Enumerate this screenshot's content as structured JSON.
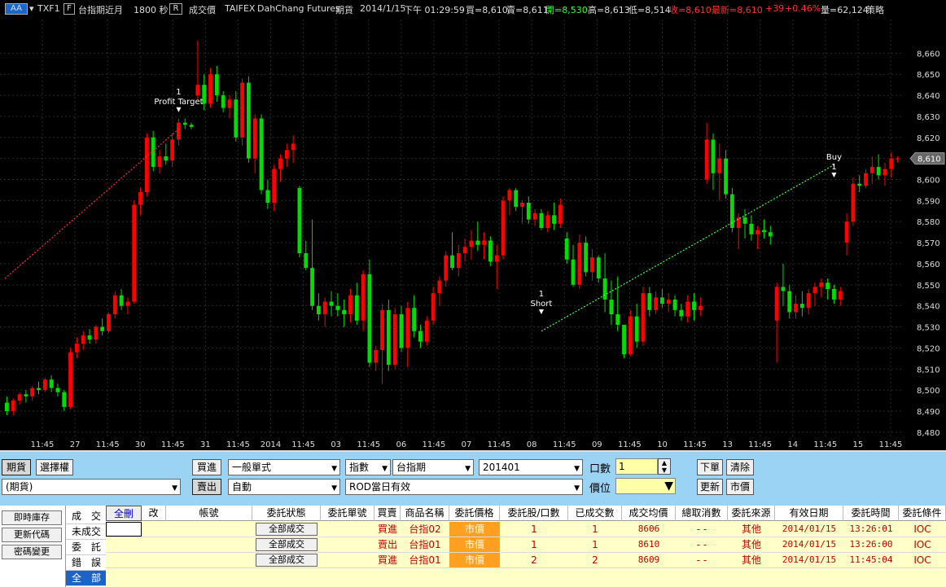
{
  "header": {
    "symbol_box": "AA",
    "symbol": "TXF1",
    "name_box": "F",
    "product": "台指期近月",
    "interval": "1800 秒",
    "r_box": "R",
    "price_type": "成交價",
    "exchange": "TAIFEX",
    "broker": "DahChang Futures",
    "category": "期貨",
    "date": "2014/1/15",
    "time": "下午 01:29:59",
    "bid": "買=8,610",
    "ask": "賣=8,611",
    "open": "開=8,530",
    "high": "高=8,613",
    "low": "低=8,514",
    "close": "收=8,610",
    "last": "最新=8,610",
    "change": "+39",
    "change_pct": "+0.46%",
    "volume": "量=62,124",
    "strategy": "策略"
  },
  "chart_data": {
    "type": "candlestick",
    "ylim": [
      8478,
      8676
    ],
    "yticks": [
      8480,
      8490,
      8500,
      8510,
      8520,
      8530,
      8540,
      8550,
      8560,
      8570,
      8580,
      8590,
      8600,
      8610,
      8620,
      8630,
      8640,
      8650,
      8660
    ],
    "ytick_labels": [
      "8,480",
      "8,490",
      "8,500",
      "8,510",
      "8,520",
      "8,530",
      "8,540",
      "8,550",
      "8,560",
      "8,570",
      "8,580",
      "8,590",
      "8,600",
      "8,610",
      "8,620",
      "8,630",
      "8,640",
      "8,650",
      "8,660"
    ],
    "last_price_label": "8,610",
    "last_price": 8610,
    "xtick_labels": [
      "11:45",
      "27",
      "11:45",
      "30",
      "11:45",
      "31",
      "11:45",
      "2014",
      "11:45",
      "03",
      "11:45",
      "06",
      "11:45",
      "07",
      "11:45",
      "08",
      "11:45",
      "09",
      "11:45",
      "10",
      "11:45",
      "13",
      "11:45",
      "14",
      "11:45",
      "15",
      "11:45"
    ],
    "candles": [
      [
        8494,
        8497,
        8488,
        8490
      ],
      [
        8490,
        8496,
        8488,
        8495
      ],
      [
        8495,
        8499,
        8493,
        8498
      ],
      [
        8498,
        8500,
        8494,
        8497
      ],
      [
        8497,
        8502,
        8495,
        8501
      ],
      [
        8501,
        8504,
        8498,
        8500
      ],
      [
        8500,
        8506,
        8499,
        8505
      ],
      [
        8505,
        8507,
        8499,
        8501
      ],
      [
        8501,
        8503,
        8497,
        8499
      ],
      [
        8499,
        8500,
        8490,
        8492
      ],
      [
        8492,
        8520,
        8491,
        8518
      ],
      [
        8518,
        8525,
        8515,
        8522
      ],
      [
        8522,
        8528,
        8519,
        8526
      ],
      [
        8526,
        8529,
        8522,
        8524
      ],
      [
        8524,
        8531,
        8522,
        8530
      ],
      [
        8530,
        8534,
        8526,
        8528
      ],
      [
        8528,
        8537,
        8527,
        8536
      ],
      [
        8536,
        8547,
        8534,
        8545
      ],
      [
        8545,
        8548,
        8538,
        8540
      ],
      [
        8540,
        8544,
        8536,
        8542
      ],
      [
        8542,
        8590,
        8541,
        8588
      ],
      [
        8588,
        8596,
        8583,
        8594
      ],
      [
        8594,
        8622,
        8592,
        8620
      ],
      [
        8620,
        8623,
        8604,
        8606
      ],
      [
        8606,
        8614,
        8603,
        8611
      ],
      [
        8611,
        8617,
        8607,
        8609
      ],
      [
        8609,
        8622,
        8606,
        8619
      ],
      [
        8619,
        8629,
        8616,
        8627
      ],
      [
        8627,
        8629,
        8624,
        8626
      ],
      [
        8626,
        8627,
        8624,
        8625
      ],
      [
        8640,
        8666,
        8638,
        8645
      ],
      [
        8645,
        8650,
        8633,
        8636
      ],
      [
        8636,
        8653,
        8634,
        8650
      ],
      [
        8650,
        8654,
        8637,
        8640
      ],
      [
        8640,
        8642,
        8632,
        8634
      ],
      [
        8634,
        8640,
        8629,
        8638
      ],
      [
        8638,
        8642,
        8618,
        8620
      ],
      [
        8620,
        8648,
        8616,
        8646
      ],
      [
        8646,
        8649,
        8608,
        8610
      ],
      [
        8610,
        8631,
        8603,
        8629
      ],
      [
        8629,
        8631,
        8593,
        8595
      ],
      [
        8595,
        8600,
        8586,
        8589
      ],
      [
        8589,
        8607,
        8585,
        8605
      ],
      [
        8605,
        8612,
        8599,
        8610
      ],
      [
        8610,
        8617,
        8606,
        8614
      ],
      [
        8614,
        8621,
        8608,
        8617
      ],
      [
        8596,
        8597,
        8563,
        8565
      ],
      [
        8565,
        8571,
        8557,
        8558
      ],
      [
        8558,
        8581,
        8538,
        8540
      ],
      [
        8540,
        8546,
        8533,
        8536
      ],
      [
        8536,
        8544,
        8530,
        8542
      ],
      [
        8542,
        8547,
        8535,
        8540
      ],
      [
        8540,
        8546,
        8535,
        8538
      ],
      [
        8538,
        8543,
        8530,
        8536
      ],
      [
        8536,
        8548,
        8532,
        8545
      ],
      [
        8545,
        8551,
        8531,
        8533
      ],
      [
        8533,
        8557,
        8528,
        8555
      ],
      [
        8555,
        8562,
        8511,
        8513
      ],
      [
        8513,
        8521,
        8509,
        8519
      ],
      [
        8519,
        8541,
        8503,
        8538
      ],
      [
        8538,
        8543,
        8509,
        8512
      ],
      [
        8512,
        8539,
        8510,
        8536
      ],
      [
        8536,
        8540,
        8518,
        8520
      ],
      [
        8520,
        8542,
        8511,
        8539
      ],
      [
        8539,
        8545,
        8525,
        8528
      ],
      [
        8528,
        8531,
        8520,
        8523
      ],
      [
        8523,
        8535,
        8521,
        8533
      ],
      [
        8533,
        8549,
        8531,
        8546
      ],
      [
        8546,
        8554,
        8540,
        8552
      ],
      [
        8552,
        8566,
        8549,
        8564
      ],
      [
        8564,
        8575,
        8557,
        8558
      ],
      [
        8558,
        8569,
        8554,
        8565
      ],
      [
        8565,
        8572,
        8561,
        8568
      ],
      [
        8568,
        8576,
        8562,
        8571
      ],
      [
        8571,
        8580,
        8566,
        8569
      ],
      [
        8569,
        8575,
        8562,
        8571
      ],
      [
        8571,
        8573,
        8559,
        8561
      ],
      [
        8561,
        8569,
        8548,
        8564
      ],
      [
        8564,
        8592,
        8562,
        8590
      ],
      [
        8590,
        8596,
        8583,
        8595
      ],
      [
        8595,
        8596,
        8585,
        8587
      ],
      [
        8587,
        8590,
        8579,
        8589
      ],
      [
        8589,
        8592,
        8579,
        8581
      ],
      [
        8581,
        8586,
        8578,
        8584
      ],
      [
        8584,
        8586,
        8576,
        8577
      ],
      [
        8577,
        8585,
        8575,
        8583
      ],
      [
        8583,
        8589,
        8576,
        8579
      ],
      [
        8579,
        8591,
        8577,
        8588
      ],
      [
        8572,
        8575,
        8560,
        8562
      ],
      [
        8562,
        8569,
        8549,
        8550
      ],
      [
        8550,
        8574,
        8548,
        8570
      ],
      [
        8570,
        8573,
        8554,
        8556
      ],
      [
        8556,
        8567,
        8552,
        8563
      ],
      [
        8563,
        8564,
        8551,
        8553
      ],
      [
        8553,
        8565,
        8537,
        8543
      ],
      [
        8543,
        8552,
        8531,
        8536
      ],
      [
        8536,
        8554,
        8528,
        8531
      ],
      [
        8531,
        8531,
        8515,
        8517
      ],
      [
        8517,
        8538,
        8516,
        8535
      ],
      [
        8535,
        8541,
        8520,
        8523
      ],
      [
        8523,
        8549,
        8521,
        8546
      ],
      [
        8546,
        8549,
        8535,
        8538
      ],
      [
        8538,
        8547,
        8536,
        8544
      ],
      [
        8544,
        8548,
        8539,
        8541
      ],
      [
        8541,
        8546,
        8537,
        8543
      ],
      [
        8543,
        8545,
        8535,
        8538
      ],
      [
        8538,
        8541,
        8533,
        8535
      ],
      [
        8535,
        8545,
        8532,
        8542
      ],
      [
        8542,
        8546,
        8533,
        8538
      ],
      [
        8538,
        8544,
        8535,
        8540
      ],
      [
        8600,
        8627,
        8598,
        8619
      ],
      [
        8619,
        8622,
        8595,
        8603
      ],
      [
        8603,
        8617,
        8590,
        8610
      ],
      [
        8610,
        8614,
        8591,
        8593
      ],
      [
        8593,
        8596,
        8575,
        8577
      ],
      [
        8577,
        8584,
        8567,
        8582
      ],
      [
        8582,
        8586,
        8572,
        8579
      ],
      [
        8579,
        8583,
        8571,
        8574
      ],
      [
        8574,
        8578,
        8567,
        8576
      ],
      [
        8576,
        8581,
        8572,
        8575
      ],
      [
        8575,
        8578,
        8569,
        8573
      ],
      [
        8533,
        8551,
        8513,
        8549
      ],
      [
        8549,
        8560,
        8540,
        8547
      ],
      [
        8547,
        8550,
        8534,
        8537
      ],
      [
        8537,
        8545,
        8534,
        8541
      ],
      [
        8541,
        8547,
        8535,
        8539
      ],
      [
        8539,
        8548,
        8536,
        8546
      ],
      [
        8546,
        8551,
        8540,
        8549
      ],
      [
        8549,
        8553,
        8544,
        8551
      ],
      [
        8551,
        8553,
        8543,
        8548
      ],
      [
        8548,
        8550,
        8541,
        8543
      ],
      [
        8543,
        8549,
        8540,
        8547
      ],
      [
        8570,
        8584,
        8564,
        8580
      ],
      [
        8580,
        8601,
        8578,
        8598
      ],
      [
        8598,
        8602,
        8594,
        8597
      ],
      [
        8597,
        8605,
        8596,
        8603
      ],
      [
        8603,
        8611,
        8598,
        8606
      ],
      [
        8606,
        8612,
        8600,
        8602
      ],
      [
        8602,
        8608,
        8597,
        8605
      ],
      [
        8605,
        8613,
        8601,
        8610
      ],
      [
        8610,
        8611,
        8608,
        8610
      ]
    ],
    "annotations": [
      {
        "text": "1",
        "text2": "Profit Target",
        "x_index": 27,
        "price": 8632
      },
      {
        "text": "1",
        "text2": "Short",
        "x_index": 84,
        "price": 8536
      },
      {
        "text": "Buy",
        "text2": "1",
        "x_index": 130,
        "price": 8601
      }
    ]
  },
  "order": {
    "tab_futures": "期貨",
    "tab_options": "選擇權",
    "account_type": "(期貨)",
    "buy_label": "買進",
    "sell_label": "賣出",
    "order_type": "一般單式",
    "auto": "自動",
    "index_label": "指數",
    "product": "台指期",
    "month": "201401",
    "rod": "ROD當日有效",
    "qty_label": "口數",
    "qty_value": "1",
    "price_label": "價位",
    "submit": "下單",
    "clear": "清除",
    "refresh": "更新",
    "market": "市價"
  },
  "left_buttons": [
    "即時庫存",
    "更新代碼",
    "密碼變更"
  ],
  "categories": [
    "成　交",
    "未成交",
    "委　託",
    "錯　誤",
    "全　部"
  ],
  "grid": {
    "headers": [
      "全刪",
      "改",
      "帳號",
      "委託狀態",
      "委託單號",
      "買賣",
      "商品名稱",
      "委託價格",
      "委託股/口數",
      "已成交數",
      "成交均價",
      "總取消數",
      "委託來源",
      "有效日期",
      "委託時間",
      "委託條件"
    ],
    "rows": [
      {
        "status": "全部成交",
        "side": "買進",
        "product": "台指02",
        "price": "市價",
        "qty": "1",
        "filled": "1",
        "avg": "8606",
        "cancel": "- -",
        "source": "其他",
        "date": "2014/01/15",
        "time": "13:26:01",
        "cond": "IOC"
      },
      {
        "status": "全部成交",
        "side": "賣出",
        "product": "台指01",
        "price": "市價",
        "qty": "1",
        "filled": "1",
        "avg": "8610",
        "cancel": "- -",
        "source": "其他",
        "date": "2014/01/15",
        "time": "13:26:00",
        "cond": "IOC"
      },
      {
        "status": "全部成交",
        "side": "買進",
        "product": "台指01",
        "price": "市價",
        "qty": "2",
        "filled": "2",
        "avg": "8609",
        "cancel": "- -",
        "source": "其他",
        "date": "2014/01/15",
        "time": "11:45:04",
        "cond": "IOC"
      }
    ]
  },
  "colors": {
    "up": "#ff0000",
    "down": "#00dd00",
    "grid": "#2a2a2a",
    "panel": "#9bd3f5",
    "row": "#ffffc8",
    "price_cell": "#ffa020",
    "category_active": "#1c63c7"
  }
}
